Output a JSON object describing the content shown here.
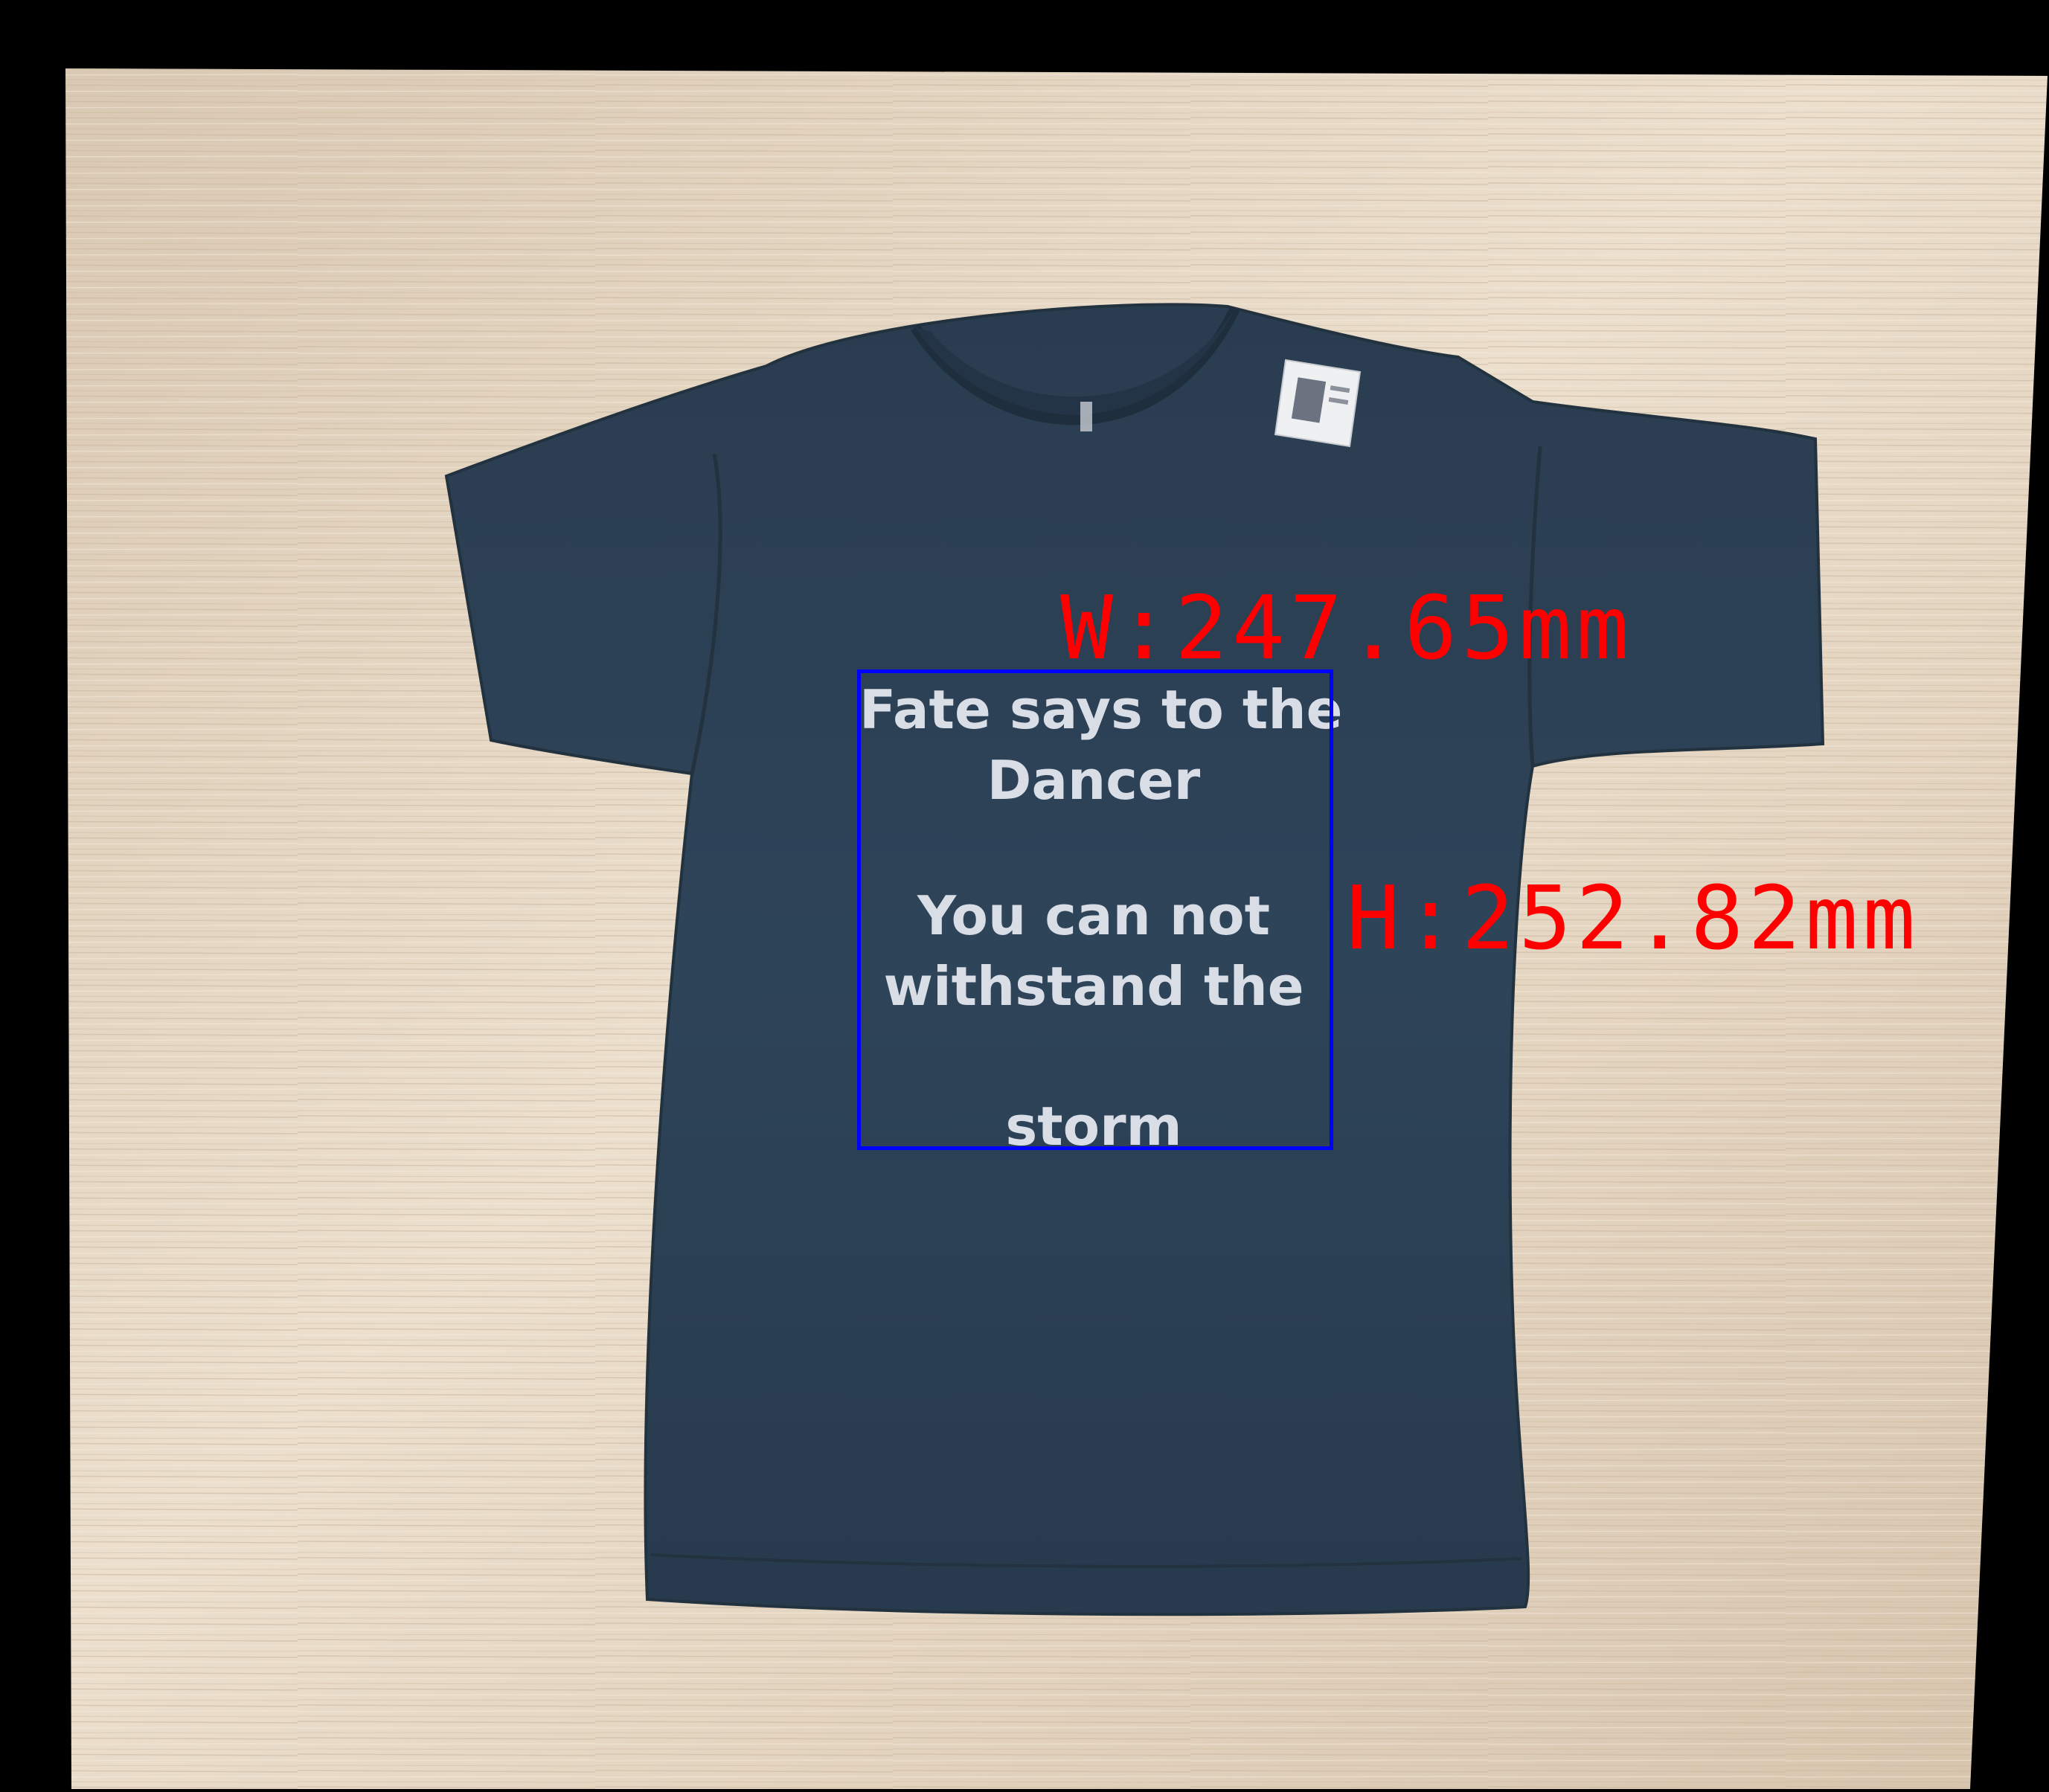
{
  "image": {
    "subject": "t-shirt",
    "shirt_color": "#2d4257",
    "background_color": "#e6d9c6",
    "frame_color": "#000000"
  },
  "print": {
    "line1": "Fate says to the",
    "line2": "Dancer",
    "line3": "You can not",
    "line4": "withstand the",
    "line5": "storm"
  },
  "measurement": {
    "width_label": "W:247.65mm",
    "height_label": "H:252.82mm",
    "box_color": "#0000ff",
    "label_color": "#ff0000"
  }
}
